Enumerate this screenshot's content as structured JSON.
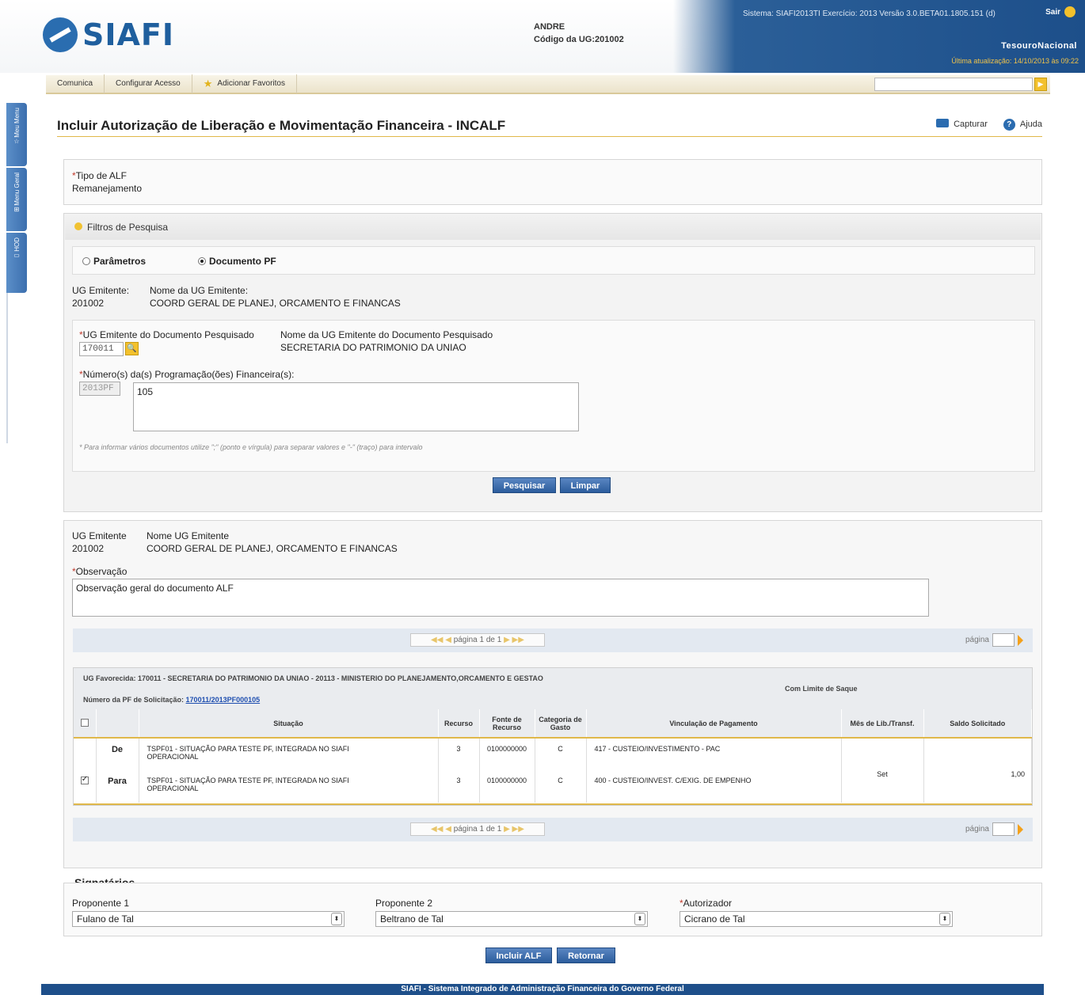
{
  "header": {
    "logo_text": "SIAFI",
    "user_name": "ANDRE",
    "ug_label": "Código da UG:",
    "ug_code": "201002",
    "system_info": "Sistema: SIAFI2013TI Exercício: 2013 Versão 3.0.BETA01.1805.151 (d)",
    "sair_label": "Sair",
    "tesouro_label": "TesouroNacional",
    "last_update": "Última atualização: 14/10/2013 às 09:22"
  },
  "menu": {
    "items": [
      "Comunica",
      "Configurar Acesso",
      "Adicionar Favoritos"
    ]
  },
  "side_tabs": [
    "Meu Menu",
    "Menu Geral",
    "HOD"
  ],
  "page": {
    "title": "Incluir Autorização de Liberação e Movimentação Financeira - INCALF",
    "capturar": "Capturar",
    "ajuda": "Ajuda"
  },
  "tipo_alf": {
    "label": "Tipo de ALF",
    "value": "Remanejamento"
  },
  "filtros": {
    "title": "Filtros de Pesquisa",
    "radio_parametros": "Parâmetros",
    "radio_documento": "Documento PF",
    "ug_emitente_label": "UG Emitente:",
    "ug_emitente_value": "201002",
    "nome_ug_label": "Nome da UG Emitente:",
    "nome_ug_value": "COORD GERAL DE PLANEJ, ORCAMENTO E FINANCAS",
    "ug_doc_label": "UG Emitente do Documento Pesquisado",
    "ug_doc_value": "170011",
    "nome_ug_doc_label": "Nome da UG Emitente do Documento Pesquisado",
    "nome_ug_doc_value": "SECRETARIA DO PATRIMONIO DA UNIAO",
    "numeros_label": "Número(s) da(s) Programação(ões) Financeira(s):",
    "prefix": "2013PF",
    "numeros_value": "105",
    "hint": "* Para informar vários documentos utilize \";\" (ponto e vírgula) para separar valores e \"-\" (traço) para intervalo",
    "pesquisar": "Pesquisar",
    "limpar": "Limpar"
  },
  "result": {
    "ug_emitente_label": "UG Emitente",
    "ug_emitente_value": "201002",
    "nome_ug_label": "Nome UG Emitente",
    "nome_ug_value": "COORD GERAL DE PLANEJ, ORCAMENTO E FINANCAS",
    "observacao_label": "Observação",
    "observacao_value": "Observação geral do documento ALF",
    "pager_text": "página 1 de 1",
    "pagina_label": "página",
    "ug_favorecida": "UG Favorecida: 170011 - SECRETARIA DO PATRIMONIO DA UNIAO - 20113 - MINISTERIO DO PLANEJAMENTO,ORCAMENTO E GESTAO",
    "pf_label": "Número da PF de Solicitação:",
    "pf_link": "170011/2013PF000105",
    "limite": "Com Limite de Saque",
    "columns": [
      "Situação",
      "Recurso",
      "Fonte de Recurso",
      "Categoria de Gasto",
      "Vinculação de Pagamento",
      "Mês de Lib./Transf.",
      "Saldo Solicitado"
    ],
    "rows": [
      {
        "tipo": "De",
        "situacao": "TSPF01 - SITUAÇÃO PARA TESTE PF, INTEGRADA NO SIAFI OPERACIONAL",
        "recurso": "3",
        "fonte": "0100000000",
        "categoria": "C",
        "vinculacao": "417 - CUSTEIO/INVESTIMENTO - PAC"
      },
      {
        "tipo": "Para",
        "situacao": "TSPF01 - SITUAÇÃO PARA TESTE PF, INTEGRADA NO SIAFI OPERACIONAL",
        "recurso": "3",
        "fonte": "0100000000",
        "categoria": "C",
        "vinculacao": "400 - CUSTEIO/INVEST. C/EXIG. DE EMPENHO"
      }
    ],
    "mes": "Set",
    "saldo": "1,00"
  },
  "signatarios": {
    "title": "Signatários",
    "proponente1_label": "Proponente 1",
    "proponente1_value": "Fulano de Tal",
    "proponente2_label": "Proponente 2",
    "proponente2_value": "Beltrano de Tal",
    "autorizador_label": "Autorizador",
    "autorizador_value": "Cicrano de Tal"
  },
  "actions": {
    "incluir": "Incluir ALF",
    "retornar": "Retornar"
  },
  "footer": "SIAFI - Sistema Integrado de Administração Financeira do Governo Federal"
}
